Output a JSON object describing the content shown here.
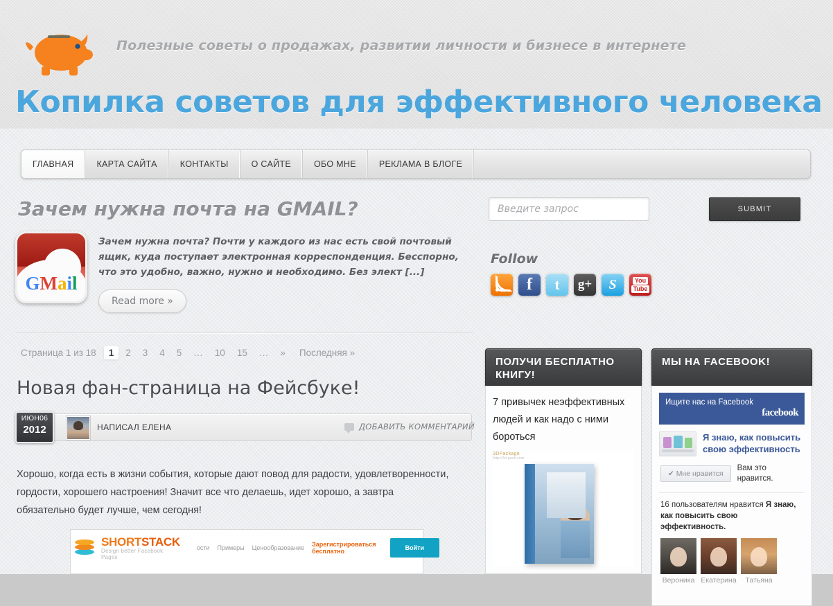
{
  "header": {
    "tagline": "Полезные советы о продажах, развитии личности и бизнесе в интернете",
    "site_title": "Копилка советов для эффективного человека",
    "logo_icon": "piggy-bank-icon",
    "accent_color": "#4ba6dd",
    "logo_color": "#f5821f"
  },
  "nav": {
    "items": [
      {
        "label": "ГЛАВНАЯ",
        "active": true
      },
      {
        "label": "КАРТА САЙТА",
        "active": false
      },
      {
        "label": "КОНТАКТЫ",
        "active": false
      },
      {
        "label": "О САЙТЕ",
        "active": false
      },
      {
        "label": "ОБО МНЕ",
        "active": false
      },
      {
        "label": "РЕКЛАМА В БЛОГЕ",
        "active": false
      }
    ]
  },
  "featured": {
    "title": "Зачем нужна почта на GMAIL?",
    "thumb_icon": "gmail-icon",
    "excerpt": "Зачем нужна почта? Почти у каждого из нас есть свой почтовый ящик, куда поступает электронная корреспонденция. Бесспорно, что это удобно, важно, нужно и необходимо. Без элект [...]",
    "read_more": "Read more »"
  },
  "search": {
    "placeholder": "Введите запрос",
    "value": "",
    "submit_label": "SUBMIT"
  },
  "follow": {
    "title": "Follow",
    "icons": [
      {
        "name": "rss-icon",
        "label": ""
      },
      {
        "name": "facebook-icon",
        "label": "f"
      },
      {
        "name": "twitter-icon",
        "label": "t"
      },
      {
        "name": "google-plus-icon",
        "label": "g+"
      },
      {
        "name": "skype-icon",
        "label": "S"
      },
      {
        "name": "youtube-icon",
        "label_top": "You",
        "label_bottom": "Tube"
      }
    ]
  },
  "pagination": {
    "label": "Страница 1 из 18",
    "pages": [
      "1",
      "2",
      "3",
      "4",
      "5",
      "…",
      "10",
      "15",
      "…",
      "»"
    ],
    "current": "1",
    "last_label": "Последняя »"
  },
  "post": {
    "title": "Новая фан-страница на Фейсбуке!",
    "date_month": "ИЮН06",
    "date_year": "2012",
    "author": "НАПИСАЛ ЕЛЕНА",
    "comment_label": "ДОБАВИТЬ КОММЕНТАРИЙ",
    "body": "Хорошо, когда есть в жизни события, которые дают повод для радости, удовлетворенности, гордости, хорошего настроения! Значит все что делаешь, идет хорошо, а завтра обязательно будет лучше, чем сегодня!",
    "shortstack": {
      "name_light": "SHORT",
      "name_bold": "STACK",
      "sub": "Design better Facebook Pages",
      "nav": [
        "ости",
        "Примеры",
        "Ценообразование"
      ],
      "free_label": "Зарегистрироваться бесплатно",
      "login_label": "Войти"
    }
  },
  "widgets": {
    "book": {
      "title": "ПОЛУЧИ БЕСПЛАТНО КНИГУ!",
      "text": "7 привычек неэффективных людей и как надо с ними бороться",
      "watermark": "3DPackage",
      "watermark_url": "http://3d-pack.com"
    },
    "facebook": {
      "title": "МЫ НА FACEBOOK!",
      "find_us": "Ищите нас на Facebook",
      "brand": "facebook",
      "page_name": "Я знаю, как повысить свою эффективность",
      "like_button": "✔ Мне нравится",
      "you_like": "Вам это нравится.",
      "count_text": "16 пользователям нравится ",
      "count_page": "Я знаю, как повысить свою эффективность.",
      "fans": [
        "Вероника",
        "Екатерина",
        "Татьяна"
      ]
    }
  }
}
